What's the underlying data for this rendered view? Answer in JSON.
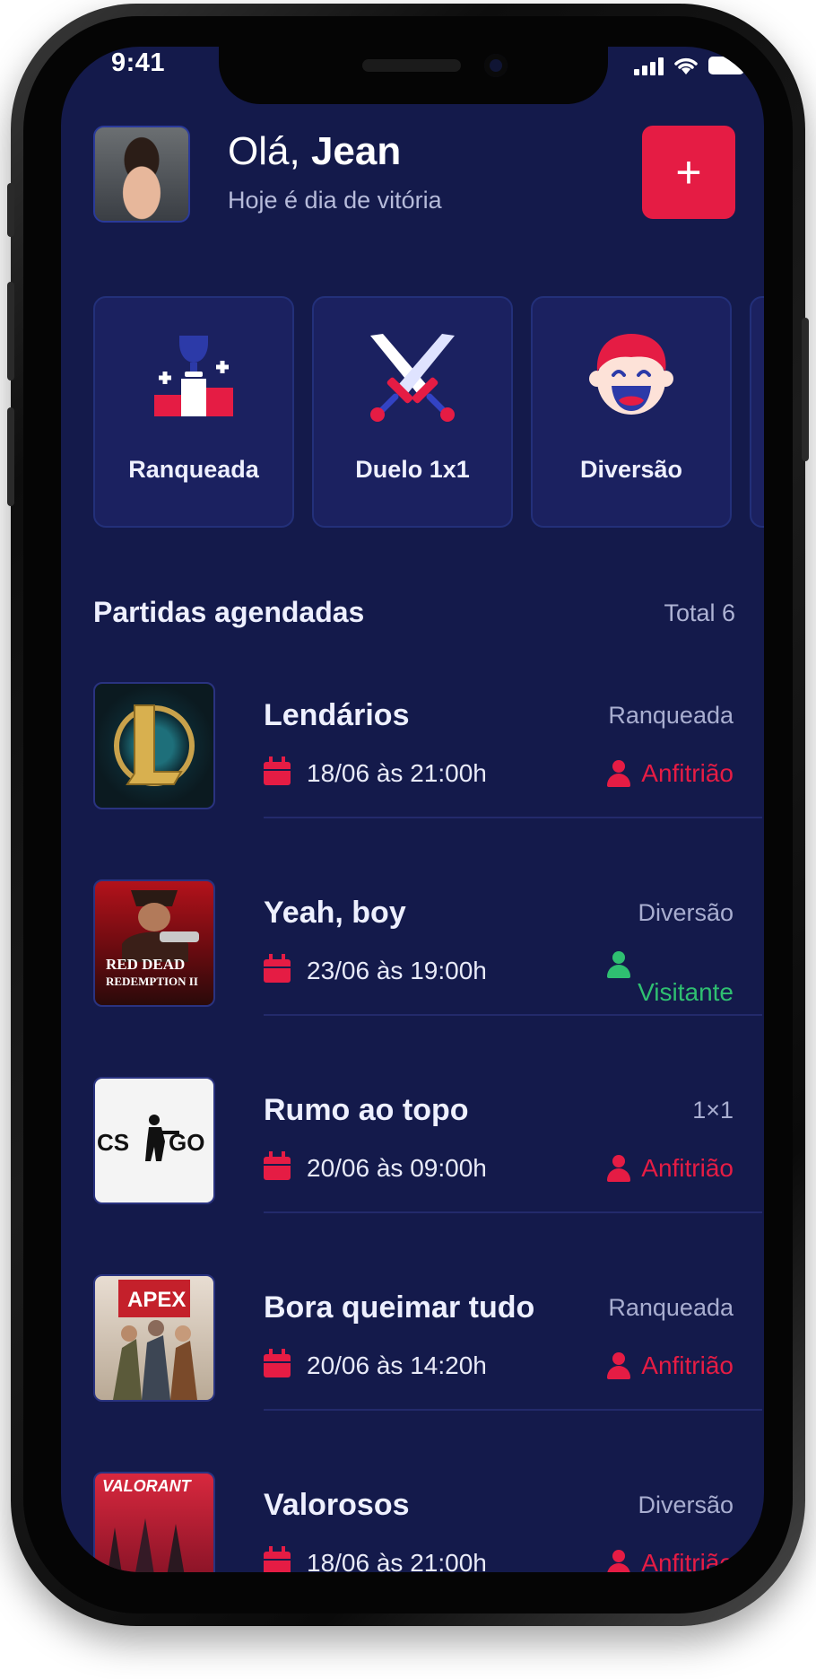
{
  "status_bar": {
    "time": "9:41"
  },
  "header": {
    "greeting_prefix": "Olá,",
    "user_name": "Jean",
    "subtitle": "Hoje é dia de vitória",
    "add_label": "+"
  },
  "categories": [
    {
      "label": "Ranqueada",
      "icon": "trophy-podium-icon"
    },
    {
      "label": "Duelo 1x1",
      "icon": "crossed-swords-icon"
    },
    {
      "label": "Diversão",
      "icon": "laughing-face-icon"
    }
  ],
  "section": {
    "title": "Partidas agendadas",
    "total": "Total 6"
  },
  "matches": [
    {
      "title": "Lendários",
      "type": "Ranqueada",
      "date": "18/06 às 21:00h",
      "role": "Anfitrião",
      "role_color": "#e51c44",
      "game_icon": "league-of-legends-logo"
    },
    {
      "title": "Yeah, boy",
      "type": "Diversão",
      "date": "23/06 às 19:00h",
      "role": "Visitante",
      "role_color": "#2fbf71",
      "game_icon": "red-dead-redemption-2-cover"
    },
    {
      "title": "Rumo ao topo",
      "type": "1×1",
      "date": "20/06 às 09:00h",
      "role": "Anfitrião",
      "role_color": "#e51c44",
      "game_icon": "csgo-logo"
    },
    {
      "title": "Bora queimar tudo",
      "type": "Ranqueada",
      "date": "20/06 às 14:20h",
      "role": "Anfitrião",
      "role_color": "#e51c44",
      "game_icon": "apex-legends-cover"
    },
    {
      "title": "Valorosos",
      "type": "Diversão",
      "date": "18/06 às 21:00h",
      "role": "Anfitrião",
      "role_color": "#e51c44",
      "game_icon": "valorant-cover"
    }
  ],
  "colors": {
    "background": "#141a4b",
    "card": "#1b2160",
    "accent": "#e51c44",
    "visitor": "#2fbf71"
  }
}
